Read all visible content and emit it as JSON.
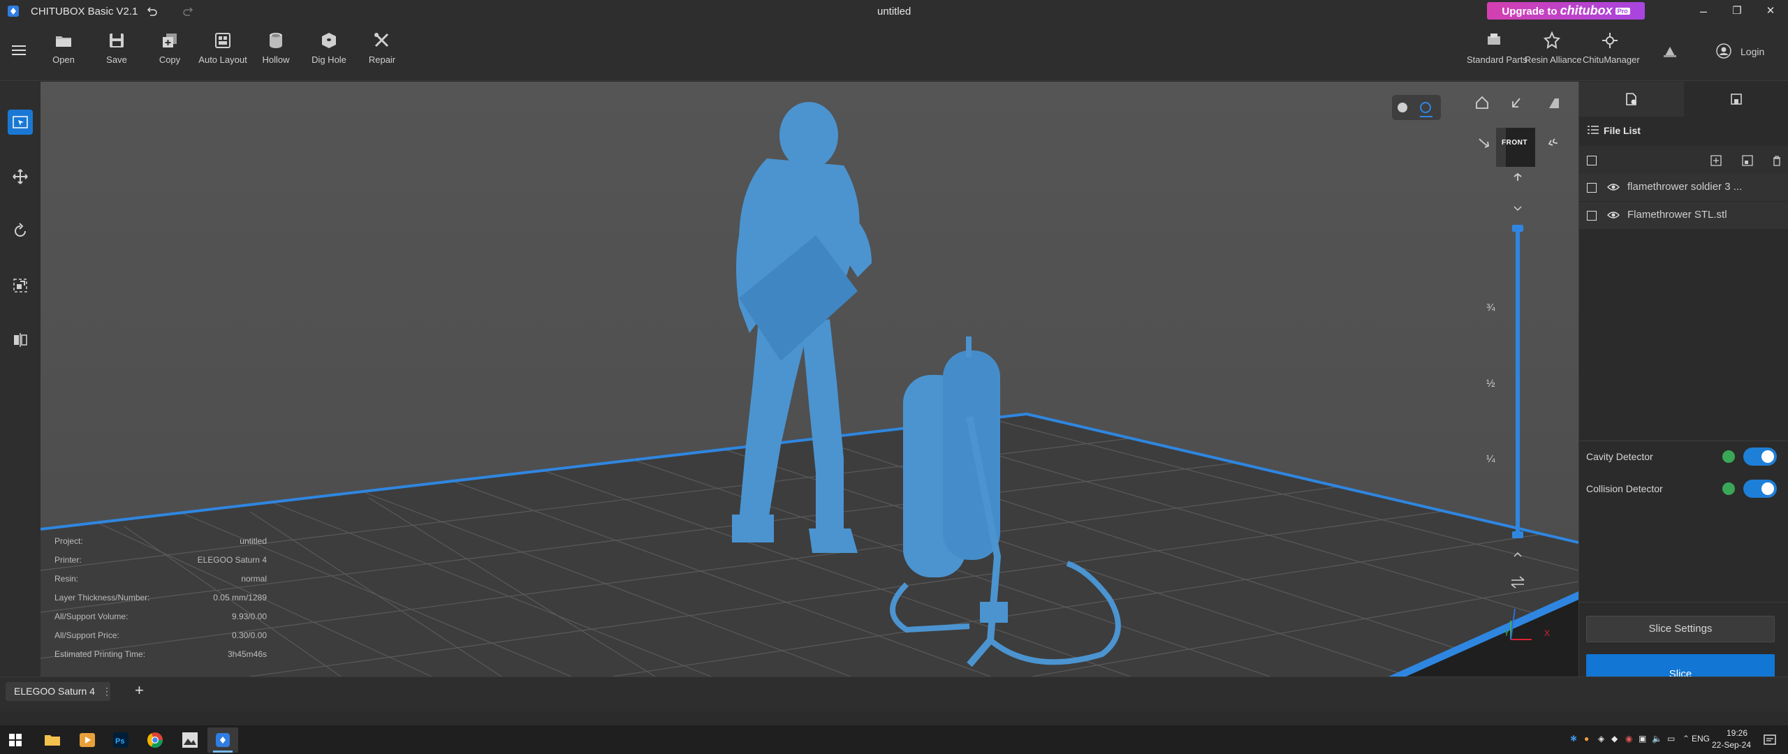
{
  "window": {
    "app_title": "CHITUBOX Basic V2.1",
    "doc_title": "untitled",
    "upgrade_prefix": "Upgrade to",
    "upgrade_brand": "chitubox",
    "upgrade_badge": "Pro",
    "minimize_icon": "–",
    "maximize_icon": "❐",
    "close_icon": "✕"
  },
  "toolbar": {
    "left": [
      {
        "label": "Open",
        "icon": "folder-icon"
      },
      {
        "label": "Save",
        "icon": "save-icon"
      },
      {
        "label": "Copy",
        "icon": "copy-icon"
      },
      {
        "label": "Auto Layout",
        "icon": "auto-layout-icon"
      },
      {
        "label": "Hollow",
        "icon": "hollow-icon"
      },
      {
        "label": "Dig Hole",
        "icon": "dig-hole-icon"
      },
      {
        "label": "Repair",
        "icon": "repair-icon"
      }
    ],
    "right": [
      {
        "label": "Standard Parts",
        "icon": "standard-parts-icon"
      },
      {
        "label": "Resin Alliance",
        "icon": "resin-alliance-icon"
      },
      {
        "label": "ChituManager",
        "icon": "chitu-manager-icon"
      }
    ],
    "login_label": "Login"
  },
  "viewport": {
    "view_cube_label": "FRONT",
    "layer_marks": [
      "¾",
      "½",
      "¼"
    ],
    "axis_x": "X",
    "axis_y": "Y"
  },
  "info": [
    {
      "key": "Project:",
      "value": "untitled"
    },
    {
      "key": "Printer:",
      "value": "ELEGOO Saturn 4"
    },
    {
      "key": "Resin:",
      "value": "normal"
    },
    {
      "key": "Layer Thickness/Number:",
      "value": "0.05 mm/1289"
    },
    {
      "key": "All/Support Volume:",
      "value": "9.93/0.00"
    },
    {
      "key": "All/Support Price:",
      "value": "0.30/0.00"
    },
    {
      "key": "Estimated Printing Time:",
      "value": "3h45m46s"
    }
  ],
  "panel": {
    "file_list_title": "File List",
    "files": [
      "flamethrower soldier 3 ...",
      "Flamethrower STL.stl"
    ],
    "cavity_detector": "Cavity Detector",
    "collision_detector": "Collision Detector",
    "slice_settings": "Slice Settings",
    "slice": "Slice"
  },
  "bottom": {
    "printer_tab": "ELEGOO Saturn 4",
    "add_tab": "+"
  },
  "taskbar": {
    "lang": "ENG",
    "time": "19:26",
    "date": "22-Sep-24"
  },
  "colors": {
    "accent": "#1176d4",
    "model": "#4b94d0"
  }
}
